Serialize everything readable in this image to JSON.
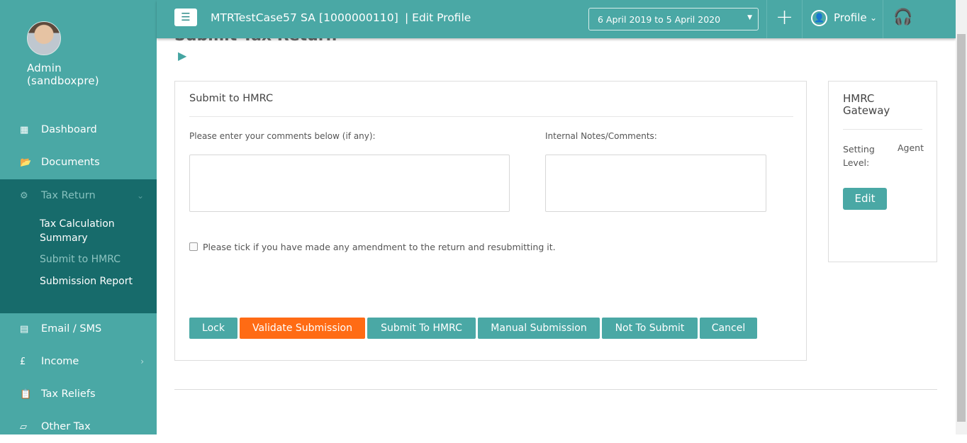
{
  "sidebar": {
    "user_name": "Admin\n(sandboxpre)",
    "items": [
      {
        "label": "Dashboard",
        "icon": "dashboard-icon"
      },
      {
        "label": "Documents",
        "icon": "documents-icon"
      },
      {
        "label": "Tax Return",
        "icon": "tax-return-icon"
      },
      {
        "label": "Email / SMS",
        "icon": "email-icon"
      },
      {
        "label": "Income",
        "icon": "pound-icon"
      },
      {
        "label": "Tax Reliefs",
        "icon": "clipboard-icon"
      },
      {
        "label": "Other Tax",
        "icon": "other-tax-icon"
      }
    ],
    "tax_return_subitems": [
      {
        "label": "Tax Calculation\nSummary"
      },
      {
        "label": "Submit to HMRC"
      },
      {
        "label": "Submission Report"
      }
    ]
  },
  "header": {
    "client_name": "MTRTestCase57 SA [1000000110]",
    "section": "| Edit Profile",
    "period": "6 April 2019 to 5 April 2020",
    "profile_label": "Profile"
  },
  "main": {
    "page_title": "Submit Tax Return",
    "panel_title": "Submit to HMRC",
    "comments_label": "Please enter your comments below (if any):",
    "internal_notes_label": "Internal Notes/Comments:",
    "amend_label": "Please tick if you have made any amendment to the return and resubmitting it.",
    "buttons": {
      "lock": "Lock",
      "validate": "Validate Submission",
      "submit": "Submit To HMRC",
      "manual": "Manual Submission",
      "not_submit": "Not To Submit",
      "cancel": "Cancel"
    }
  },
  "gateway": {
    "title": "HMRC Gateway",
    "setting_label": "Setting Level:",
    "setting_value": "Agent",
    "edit_label": "Edit"
  },
  "colors": {
    "brand_teal": "#4aa8a5",
    "dark_teal": "#176b6b",
    "accent_orange": "#ff6b14"
  }
}
